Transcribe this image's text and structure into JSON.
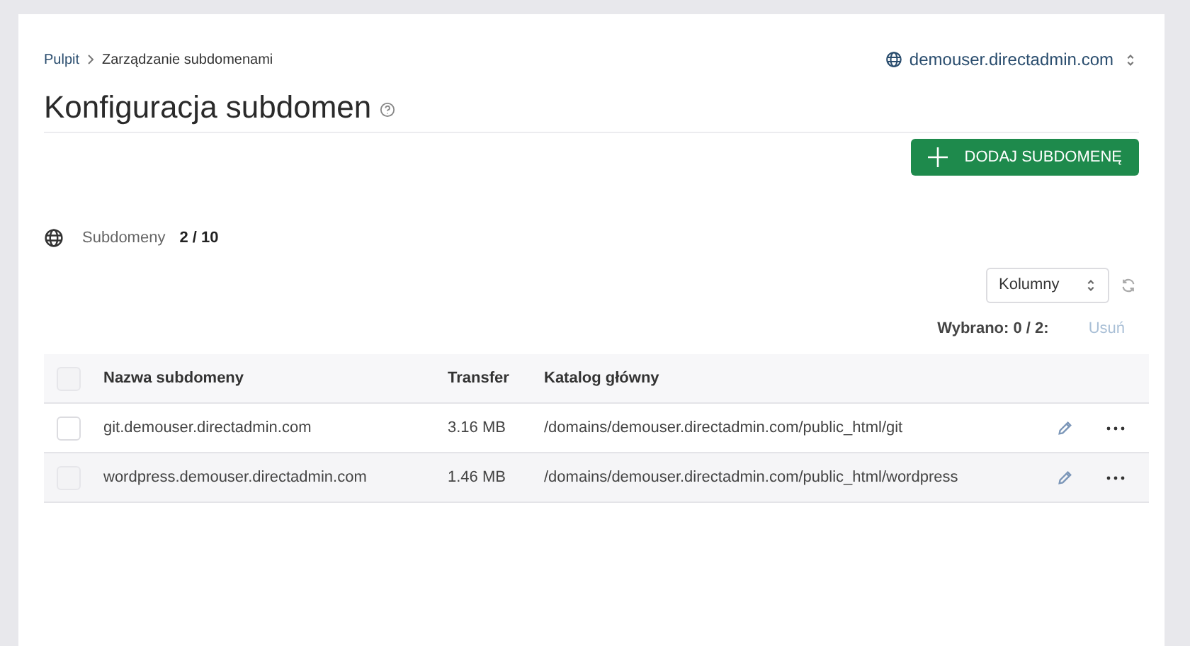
{
  "breadcrumbs": [
    {
      "label": "Pulpit"
    },
    {
      "label": "Zarządzanie subdomenami"
    }
  ],
  "domain_selector": {
    "value": "demouser.directadmin.com"
  },
  "title": "Konfiguracja subdomen",
  "add_button": {
    "label": "DODAJ SUBDOMENĘ"
  },
  "counter": {
    "label": "Subdomeny",
    "value": "2 / 10"
  },
  "columns_select": {
    "value": "Kolumny"
  },
  "selection": {
    "label": "Wybrano: 0 / 2:",
    "delete_label": "Usuń",
    "delete_disabled": true
  },
  "table": {
    "all_checked": false,
    "columns": [
      "Nazwa subdomeny",
      "Transfer",
      "Katalog główny"
    ],
    "rows": [
      {
        "name": "git.demouser.directadmin.com",
        "transfer": "3.16 MB",
        "path": "/domains/demouser.directadmin.com/public_html/git",
        "selected": false
      },
      {
        "name": "wordpress.demouser.directadmin.com",
        "transfer": "1.46 MB",
        "path": "/domains/demouser.directadmin.com/public_html/wordpress",
        "selected": false
      }
    ]
  }
}
